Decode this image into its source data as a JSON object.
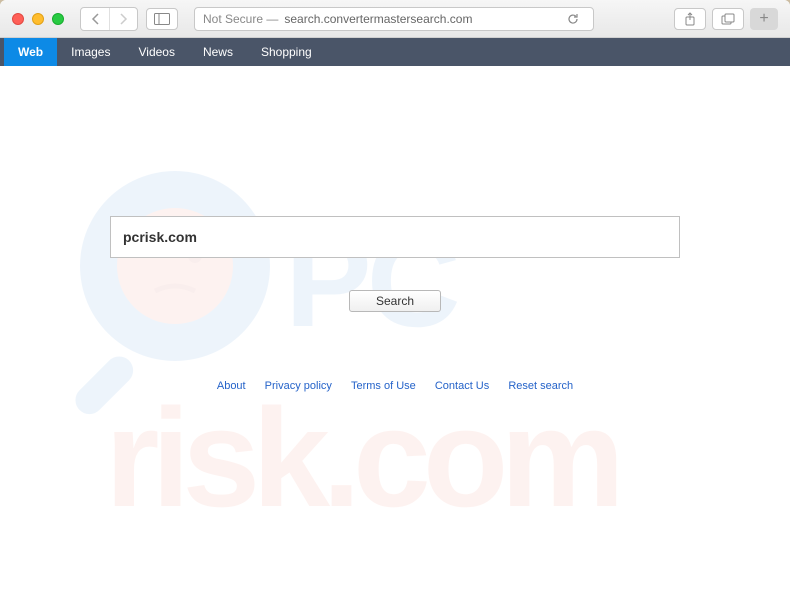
{
  "browser": {
    "security_label": "Not Secure —",
    "url": "search.convertermastersearch.com"
  },
  "tabs": [
    {
      "label": "Web",
      "active": true
    },
    {
      "label": "Images",
      "active": false
    },
    {
      "label": "Videos",
      "active": false
    },
    {
      "label": "News",
      "active": false
    },
    {
      "label": "Shopping",
      "active": false
    }
  ],
  "search": {
    "value": "pcrisk.com",
    "button_label": "Search"
  },
  "footer": {
    "about": "About",
    "privacy": "Privacy policy",
    "terms": "Terms of Use",
    "contact": "Contact Us",
    "reset": "Reset search"
  }
}
